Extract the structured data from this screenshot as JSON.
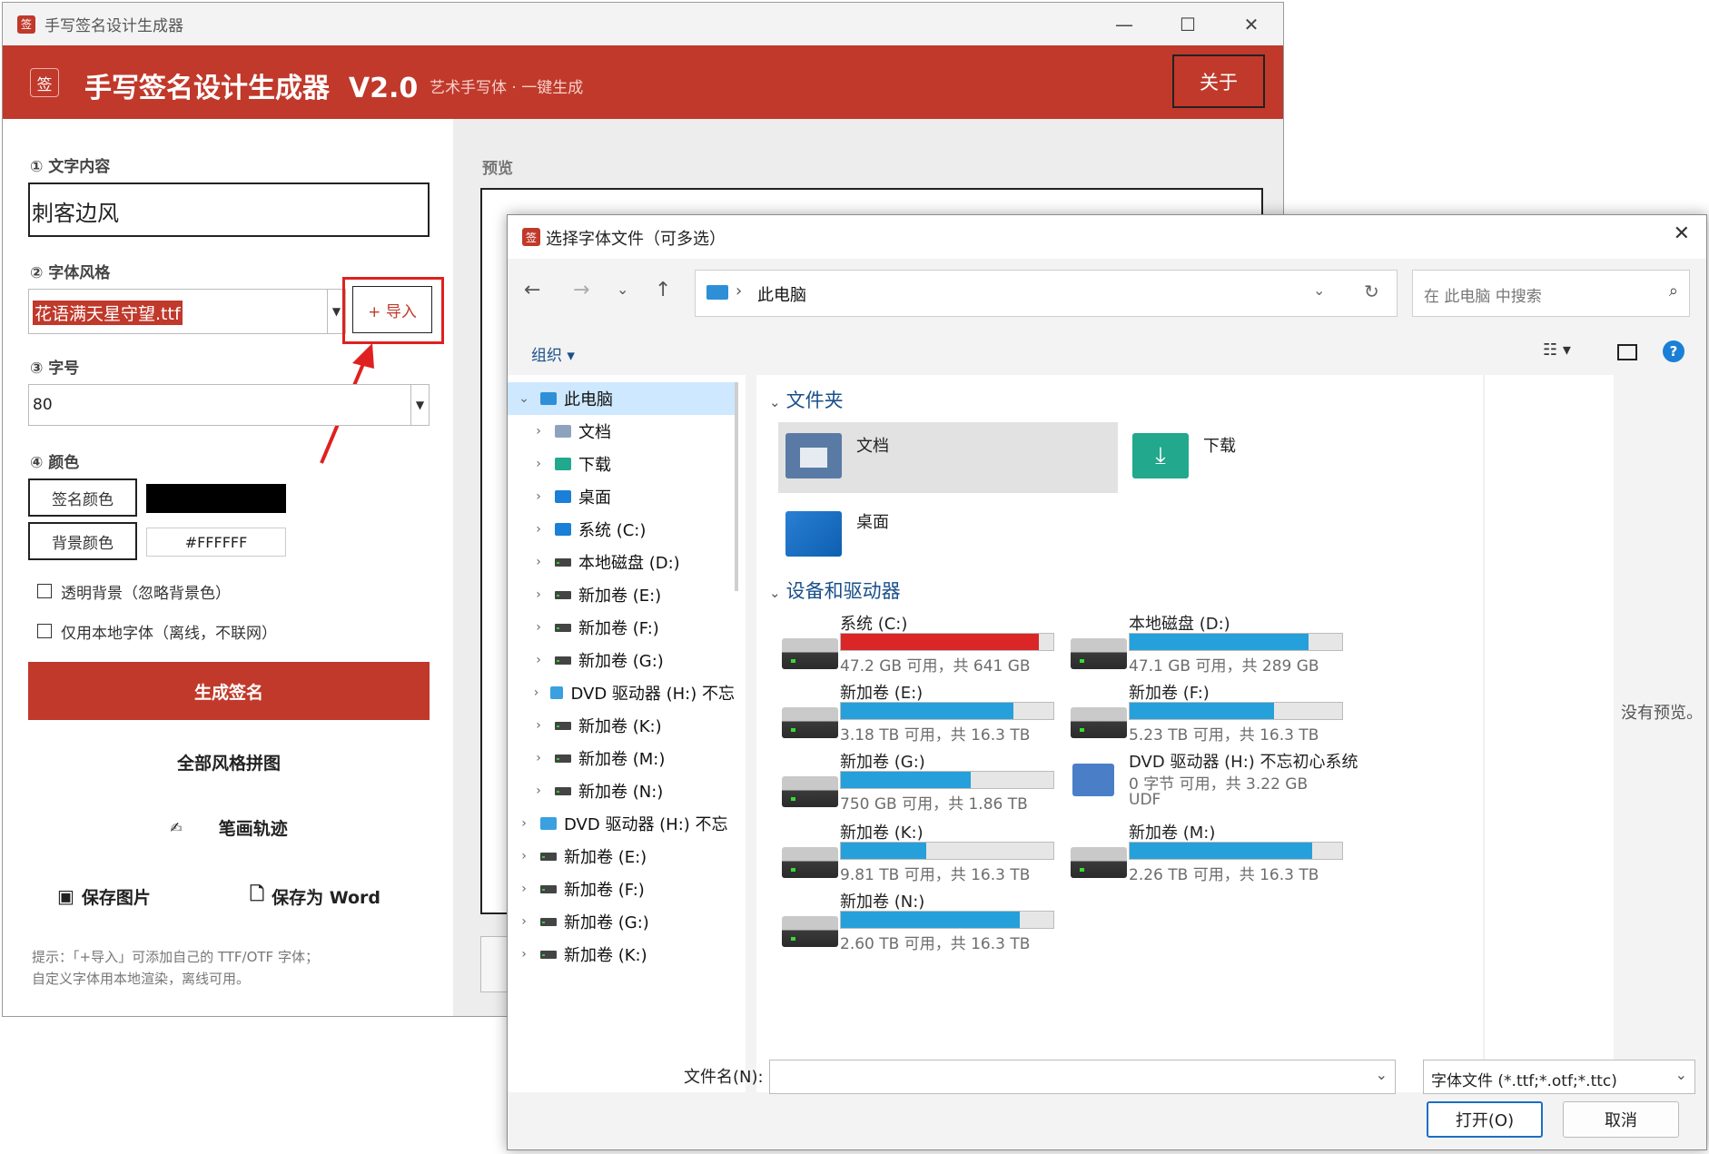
{
  "main": {
    "window_title": "手写签名设计生成器",
    "header": {
      "logo_char": "签",
      "title": "手写签名设计生成器  V2.0",
      "subtitle": "艺术手写体 · 一键生成",
      "about_label": "关于",
      "accent_color": "#c0392b"
    },
    "left": {
      "text_label": "① 文字内容",
      "text_value": "刺客边风",
      "font_label": "② 字体风格",
      "font_value": "花语满天星守望.ttf",
      "import_label": "+ 导入",
      "size_label": "③ 字号",
      "size_value": "80",
      "color_label": "④ 颜色",
      "sig_color_label": "签名颜色",
      "sig_color": "#000000",
      "bg_color_label": "背景颜色",
      "bg_color_value": "#FFFFFF",
      "transparent_label": "透明背景（忽略背景色）",
      "local_only_label": "仅用本地字体（离线，不联网）",
      "generate_label": "生成签名",
      "collage_label": "全部风格拼图",
      "stroke_label": "笔画轨迹",
      "save_image_label": "保存图片",
      "save_word_label": "保存为 Word",
      "tip_line1": "提示：「+导入」可添加自己的 TTF/OTF 字体；",
      "tip_line2": "自定义字体用本地渲染，离线可用。"
    },
    "right": {
      "preview_label": "预览"
    }
  },
  "dialog": {
    "title": "选择字体文件（可多选）",
    "address": "此电脑",
    "search_placeholder": "在 此电脑 中搜索",
    "organize_label": "组织 ▾",
    "tree": [
      {
        "label": "此电脑",
        "level": 0,
        "expanded": true,
        "icon": "pc-icon"
      },
      {
        "label": "文档",
        "level": 1,
        "icon": "document-icon"
      },
      {
        "label": "下载",
        "level": 1,
        "icon": "download-icon"
      },
      {
        "label": "桌面",
        "level": 1,
        "icon": "desktop-icon"
      },
      {
        "label": "系统 (C:)",
        "level": 1,
        "icon": "windows-drive-icon"
      },
      {
        "label": "本地磁盘 (D:)",
        "level": 1,
        "icon": "drive-icon"
      },
      {
        "label": "新加卷 (E:)",
        "level": 1,
        "icon": "drive-icon"
      },
      {
        "label": "新加卷 (F:)",
        "level": 1,
        "icon": "drive-icon"
      },
      {
        "label": "新加卷 (G:)",
        "level": 1,
        "icon": "drive-icon"
      },
      {
        "label": "DVD 驱动器 (H:) 不忘",
        "level": 1,
        "icon": "dvd-icon"
      },
      {
        "label": "新加卷 (K:)",
        "level": 1,
        "icon": "shared-drive-icon"
      },
      {
        "label": "新加卷 (M:)",
        "level": 1,
        "icon": "drive-icon"
      },
      {
        "label": "新加卷 (N:)",
        "level": 1,
        "icon": "drive-icon"
      },
      {
        "label": "DVD 驱动器 (H:) 不忘",
        "level": 0,
        "icon": "dvd-icon"
      },
      {
        "label": "新加卷 (E:)",
        "level": 0,
        "icon": "drive-icon"
      },
      {
        "label": "新加卷 (F:)",
        "level": 0,
        "icon": "drive-icon"
      },
      {
        "label": "新加卷 (G:)",
        "level": 0,
        "icon": "drive-icon"
      },
      {
        "label": "新加卷 (K:)",
        "level": 0,
        "icon": "drive-icon"
      }
    ],
    "folders_header": "文件夹",
    "folders": [
      {
        "label": "文档"
      },
      {
        "label": "下载"
      },
      {
        "label": "桌面"
      }
    ],
    "devices_header": "设备和驱动器",
    "drives": [
      {
        "name": "系统 (C:)",
        "space": "47.2 GB 可用，共 641 GB",
        "used": 0.93,
        "critical": true
      },
      {
        "name": "本地磁盘 (D:)",
        "space": "47.1 GB 可用，共 289 GB",
        "used": 0.84
      },
      {
        "name": "新加卷 (E:)",
        "space": "3.18 TB 可用，共 16.3 TB",
        "used": 0.81
      },
      {
        "name": "新加卷 (F:)",
        "space": "5.23 TB 可用，共 16.3 TB",
        "used": 0.68
      },
      {
        "name": "新加卷 (G:)",
        "space": "750 GB 可用，共 1.86 TB",
        "used": 0.61
      },
      {
        "name": "DVD 驱动器 (H:) 不忘初心系统",
        "space": "0 字节 可用，共 3.22 GB",
        "extra": "UDF"
      },
      {
        "name": "新加卷 (K:)",
        "space": "9.81 TB 可用，共 16.3 TB",
        "used": 0.4
      },
      {
        "name": "新加卷 (M:)",
        "space": "2.26 TB 可用，共 16.3 TB",
        "used": 0.86
      },
      {
        "name": "新加卷 (N:)",
        "space": "2.60 TB 可用，共 16.3 TB",
        "used": 0.84
      }
    ],
    "no_preview": "没有预览。",
    "filename_label": "文件名(N):",
    "filename_value": "",
    "filetype_value": "字体文件 (*.ttf;*.otf;*.ttc)",
    "open_label": "打开(O)",
    "cancel_label": "取消"
  },
  "annotation": {
    "highlight_color": "#e02020"
  }
}
